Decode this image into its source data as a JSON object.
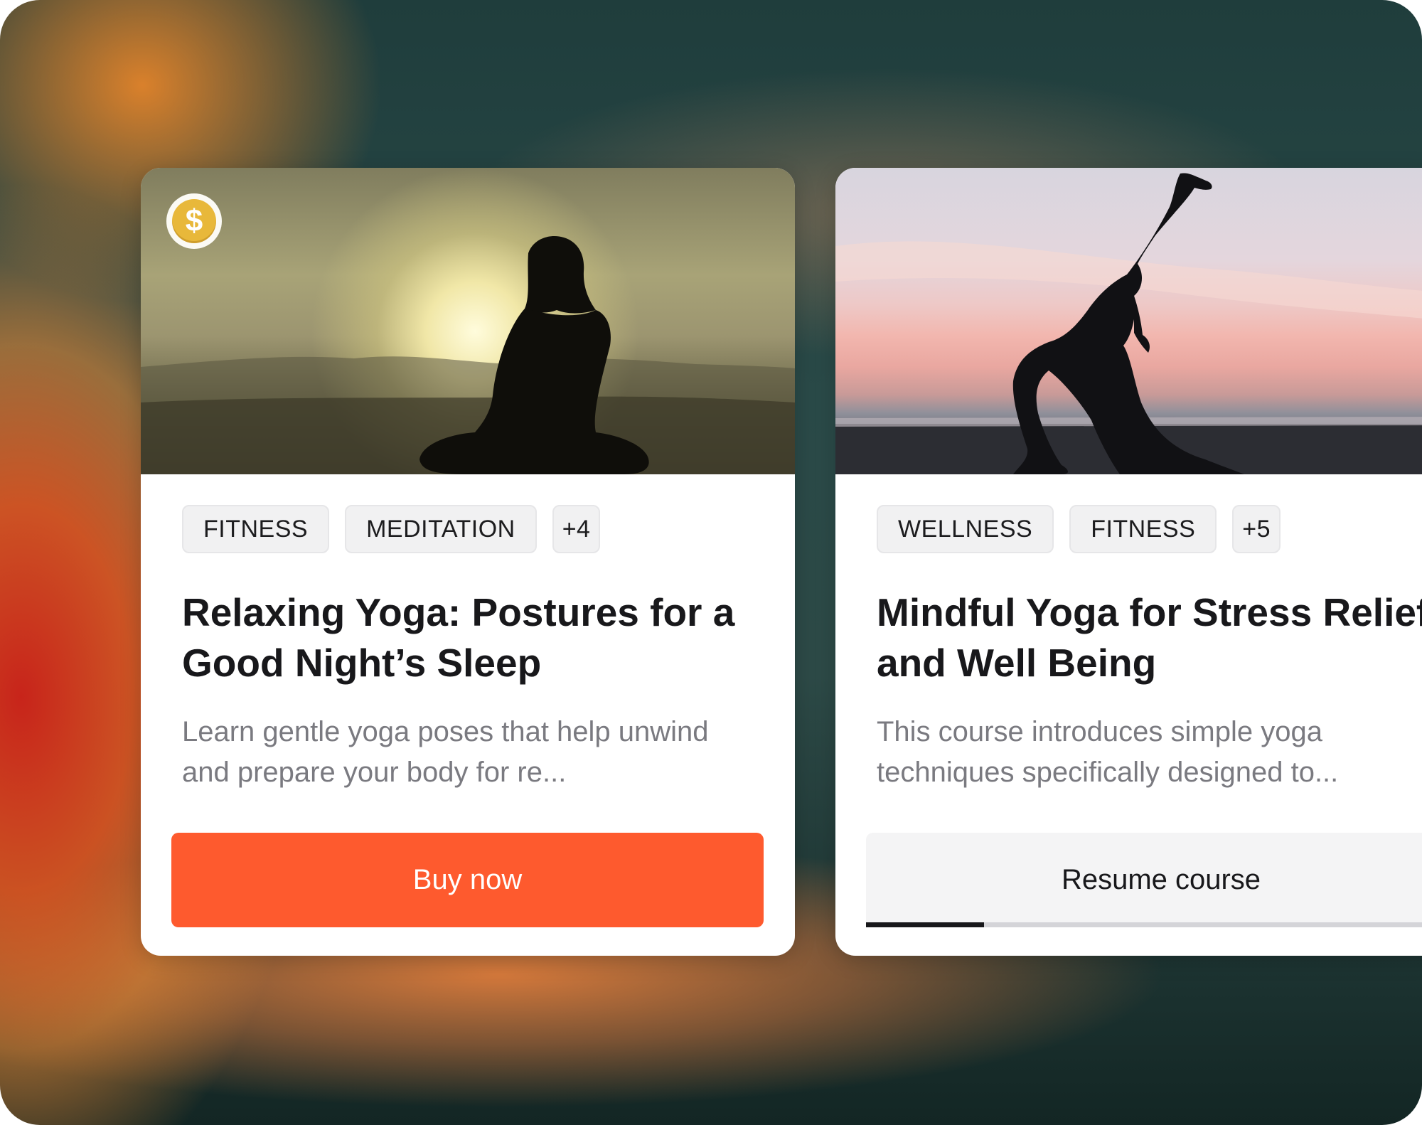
{
  "courses": [
    {
      "tags": [
        "FITNESS",
        "MEDITATION",
        "+4"
      ],
      "title": "Relaxing Yoga: Postures for a Good Night’s Sleep",
      "description": "Learn gentle yoga poses that help unwind and prepare your body for re...",
      "paid_badge_icon": "dollar-coin-icon",
      "badge_symbol": "$",
      "action_label": "Buy now",
      "action_color": "#fe5a2e"
    },
    {
      "tags": [
        "WELLNESS",
        "FITNESS",
        "+5"
      ],
      "title": "Mindful Yoga for Stress Relief and Well Being",
      "description": "This course introduces simple yoga techniques specifically designed to...",
      "action_label": "Resume course",
      "progress_fraction": 0.2
    }
  ]
}
